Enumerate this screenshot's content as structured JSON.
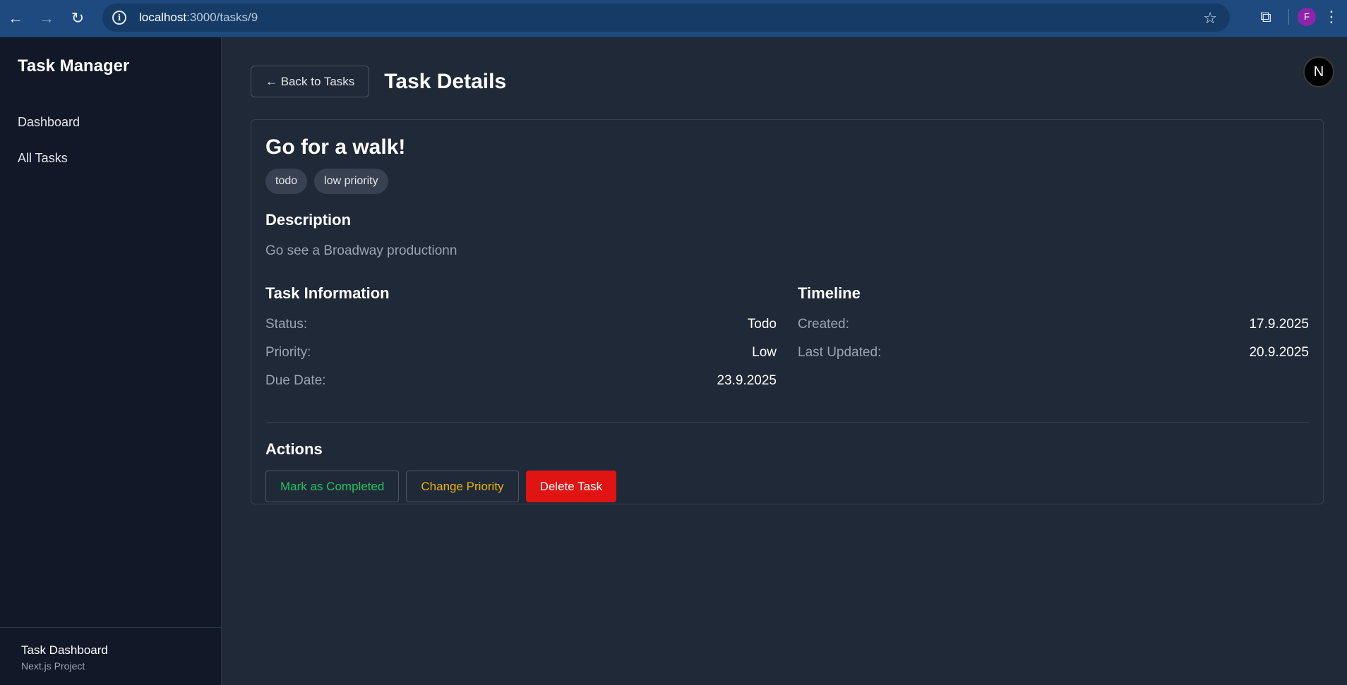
{
  "browser": {
    "url_host": "localhost",
    "url_path": ":3000/tasks/9",
    "profile_initial": "F"
  },
  "sidebar": {
    "title": "Task Manager",
    "items": [
      {
        "label": "Dashboard"
      },
      {
        "label": "All Tasks"
      }
    ],
    "footer_title": "Task Dashboard",
    "footer_subtitle": "Next.js Project"
  },
  "header": {
    "back_label": "← Back to Tasks",
    "title": "Task Details",
    "avatar_letter": "N"
  },
  "task": {
    "title": "Go for a walk!",
    "badges": [
      "todo",
      "low priority"
    ],
    "description_heading": "Description",
    "description": "Go see a Broadway productionn",
    "info_heading": "Task Information",
    "info": [
      {
        "key": "Status:",
        "value": "Todo"
      },
      {
        "key": "Priority:",
        "value": "Low"
      },
      {
        "key": "Due Date:",
        "value": "23.9.2025"
      }
    ],
    "timeline_heading": "Timeline",
    "timeline": [
      {
        "key": "Created:",
        "value": "17.9.2025"
      },
      {
        "key": "Last Updated:",
        "value": "20.9.2025"
      }
    ]
  },
  "actions": {
    "heading": "Actions",
    "complete_label": "Mark as Completed",
    "priority_label": "Change Priority",
    "delete_label": "Delete Task"
  },
  "colors": {
    "accent_green": "#22c55e",
    "accent_yellow": "#eab308",
    "danger_red": "#e11414"
  }
}
